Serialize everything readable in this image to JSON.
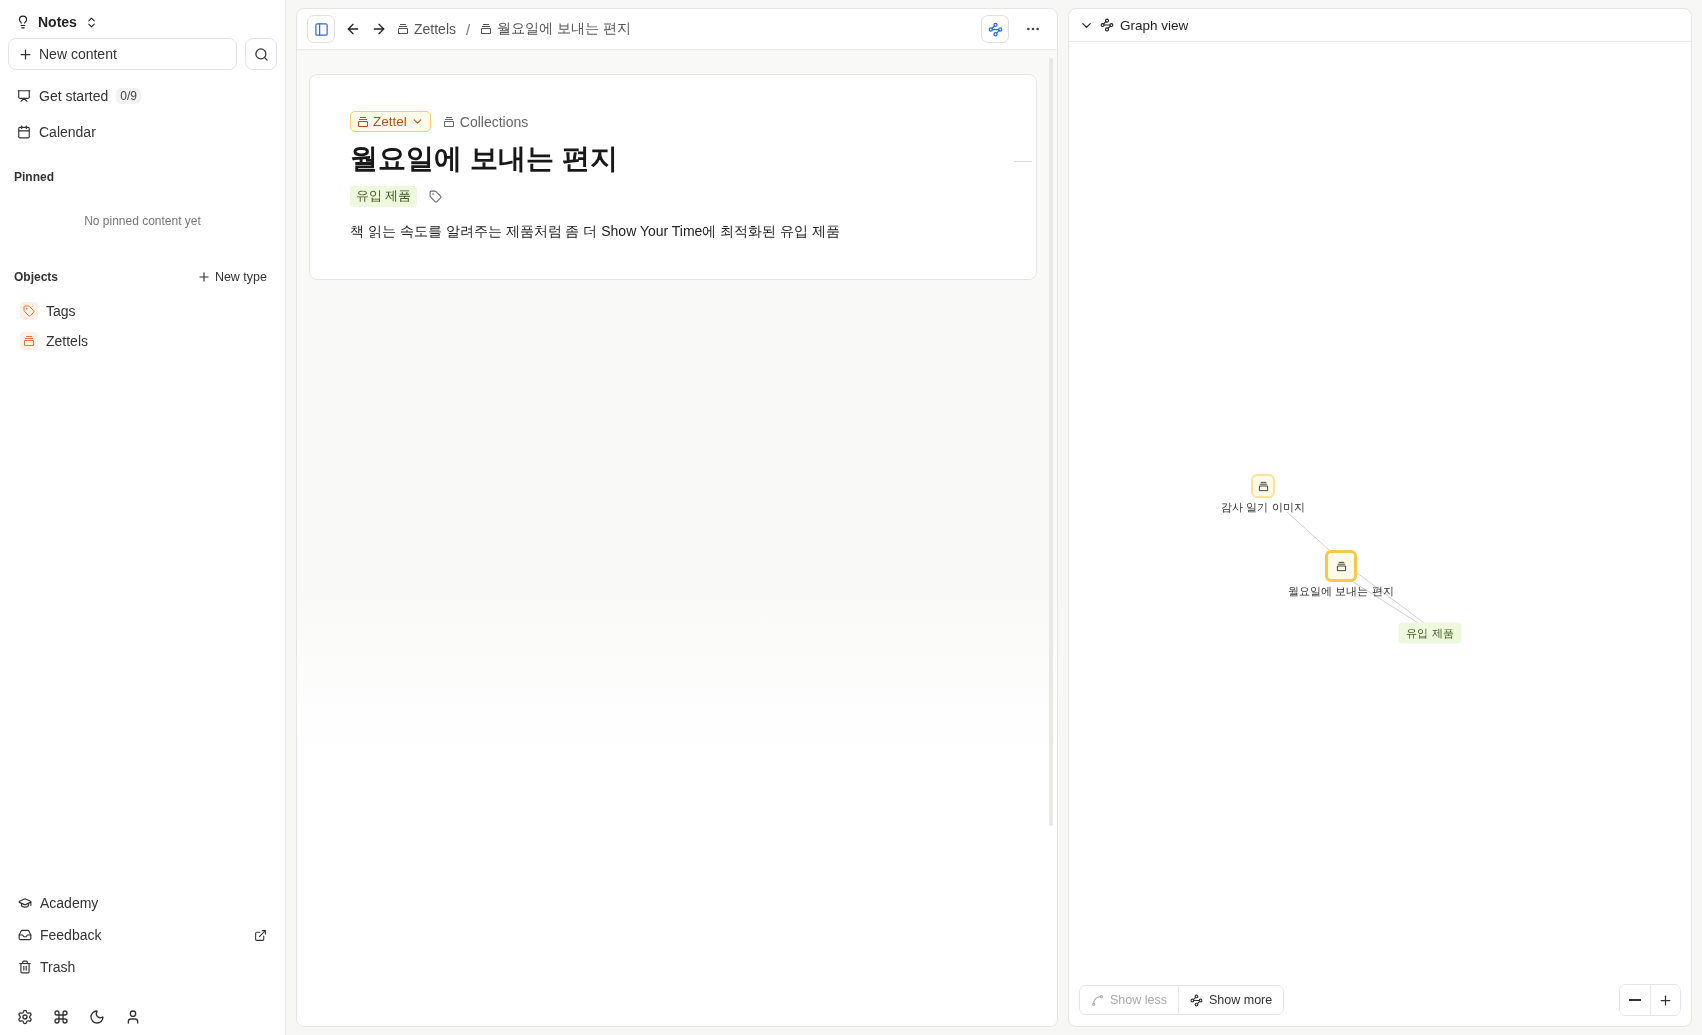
{
  "sidebar": {
    "workspace": "Notes",
    "new_content": "New content",
    "nav": [
      {
        "kind": "getstarted",
        "label": "Get started",
        "badge": "0/9"
      },
      {
        "kind": "calendar",
        "label": "Calendar"
      }
    ],
    "pinned": {
      "heading": "Pinned",
      "empty": "No pinned content yet"
    },
    "objects": {
      "heading": "Objects",
      "action": "New type",
      "items": [
        {
          "kind": "tag",
          "label": "Tags"
        },
        {
          "kind": "collection",
          "label": "Zettels"
        }
      ]
    },
    "bottom": [
      {
        "kind": "academy",
        "label": "Academy",
        "external": false
      },
      {
        "kind": "feedback",
        "label": "Feedback",
        "external": true
      },
      {
        "kind": "trash",
        "label": "Trash",
        "external": false
      }
    ]
  },
  "editor": {
    "breadcrumbs": [
      "Zettels",
      "월요일에 보내는 편지"
    ],
    "breadcrumb_separator": "/",
    "graph_toggle_on": true,
    "type": "Zettel",
    "collection": "Collections",
    "title": "월요일에 보내는 편지",
    "tags": [
      "유입 제품"
    ],
    "description": "책 읽는 속도를 알려주는 제품처럼 좀 더 Show Your Time에 최적화된 유입 제품"
  },
  "graph": {
    "title": "Graph view",
    "nodes": [
      {
        "kind": "object",
        "label": "감사 일기 이미지",
        "selected": false
      },
      {
        "kind": "object",
        "label": "월요일에 보내는 편지",
        "selected": true
      },
      {
        "kind": "tag",
        "label": "유입 제품",
        "selected": false
      }
    ],
    "buttons": [
      {
        "kind": "less",
        "label": "Show less",
        "disabled": true
      },
      {
        "kind": "more",
        "label": "Show more",
        "disabled": false
      }
    ]
  }
}
